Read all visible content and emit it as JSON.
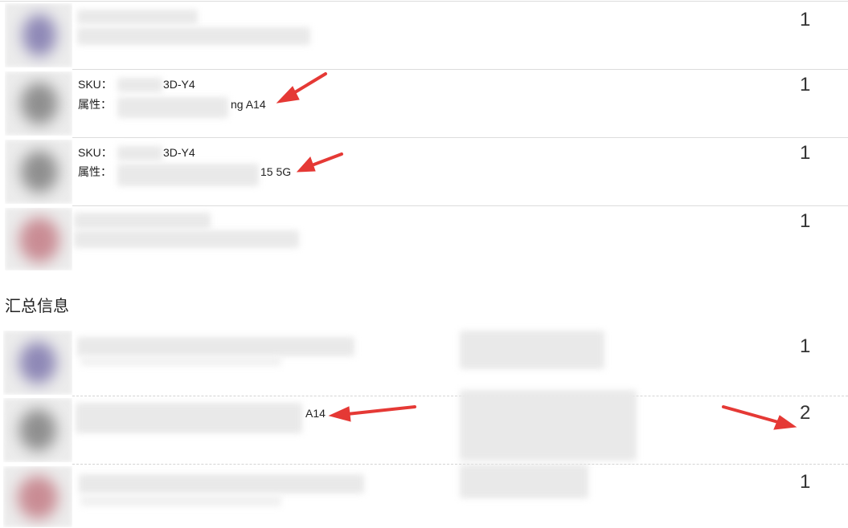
{
  "colors": {
    "annotation_arrow": "#e53935",
    "separator": "#dcdcdc"
  },
  "order_items": [
    {
      "sku_label": "",
      "sku_value": "",
      "attr_label": "",
      "attr_value": "",
      "quantity": "1",
      "thumbnail_tint": "#8e88b6"
    },
    {
      "sku_label": "SKU：",
      "sku_value": "3D-Y4",
      "attr_label": "属性：",
      "attr_value": "ng A14",
      "quantity": "1",
      "thumbnail_tint": "#8f8f8f"
    },
    {
      "sku_label": "SKU：",
      "sku_value": "3D-Y4",
      "attr_label": "属性：",
      "attr_value": "15 5G",
      "quantity": "1",
      "thumbnail_tint": "#8f8f8f"
    },
    {
      "sku_label": "",
      "sku_value": "",
      "attr_label": "",
      "attr_value": "",
      "quantity": "1",
      "thumbnail_tint": "#c98c94"
    }
  ],
  "summary": {
    "title": "汇总信息",
    "rows": [
      {
        "name_value": "",
        "quantity": "1",
        "thumbnail_tint": "#8e88b6"
      },
      {
        "name_value": "A14",
        "quantity": "2",
        "thumbnail_tint": "#8f8f8f"
      },
      {
        "name_value": "",
        "quantity": "1",
        "thumbnail_tint": "#c98c94"
      }
    ]
  }
}
